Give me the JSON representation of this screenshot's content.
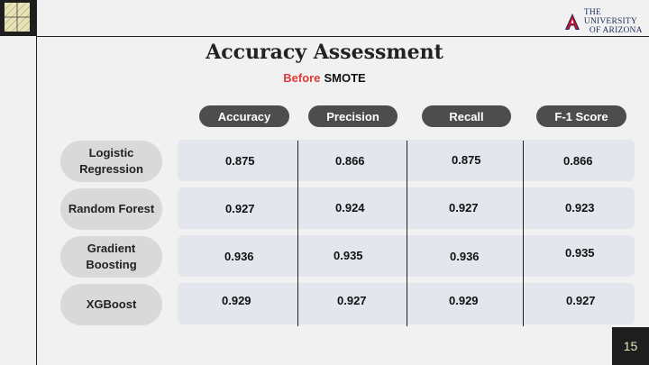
{
  "logo": {
    "line1": "THE UNIVERSITY",
    "line2": "OF ARIZONA"
  },
  "title": "Accuracy Assessment",
  "subtitle": {
    "accent": "Before",
    "rest": "SMOTE"
  },
  "columns": [
    "Accuracy",
    "Precision",
    "Recall",
    "F-1 Score"
  ],
  "rows": [
    {
      "label": "Logistic Regression",
      "values": [
        "0.875",
        "0.866",
        "0.875",
        "0.866"
      ]
    },
    {
      "label": "Random Forest",
      "values": [
        "0.927",
        "0.924",
        "0.927",
        "0.923"
      ]
    },
    {
      "label": "Gradient Boosting",
      "values": [
        "0.936",
        "0.935",
        "0.936",
        "0.935"
      ]
    },
    {
      "label": "XGBoost",
      "values": [
        "0.929",
        "0.927",
        "0.929",
        "0.927"
      ]
    }
  ],
  "page_number": "15",
  "colors": {
    "accent": "#e03a3a",
    "pill": "#4d4d4d",
    "row_bg": "#e3e7ed",
    "label_bg": "#d9d9d9",
    "dark": "#1e1e1e",
    "cream": "#e8e3b8"
  }
}
